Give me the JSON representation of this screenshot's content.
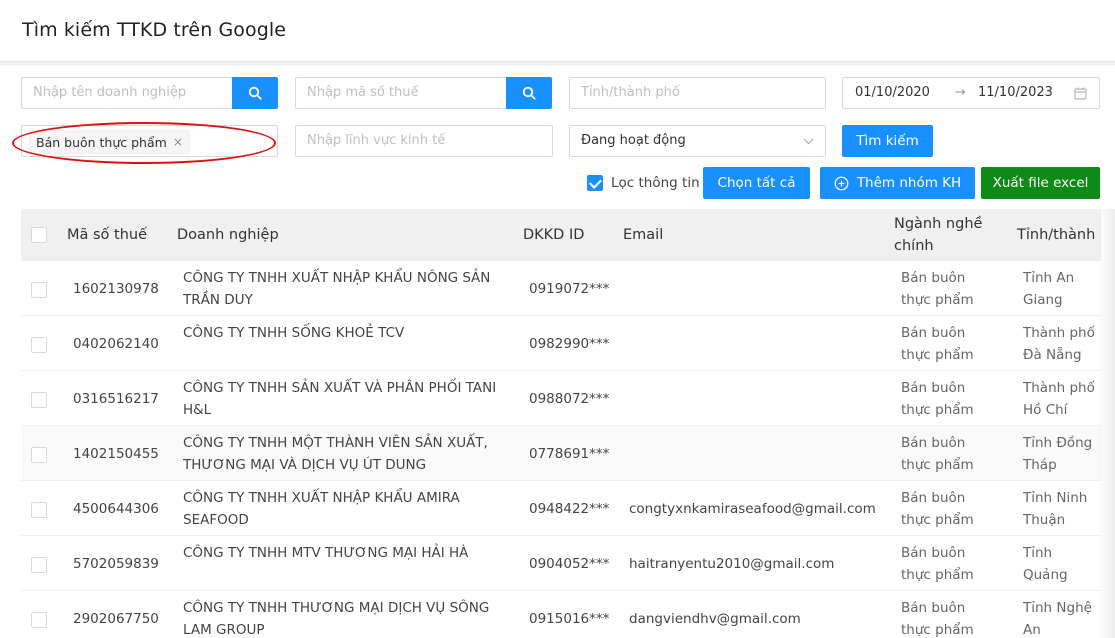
{
  "page": {
    "title": "Tìm kiếm TTKD trên Google"
  },
  "filters": {
    "company_name_placeholder": "Nhập tên doanh nghiệp",
    "tax_code_placeholder": "Nhập mã số thuế",
    "province_placeholder": "Tỉnh/thành phố",
    "date_from": "01/10/2020",
    "date_arrow": "→",
    "date_to": "11/10/2023",
    "industry_tag": "Bán buôn thực phẩm",
    "tag_close": "×",
    "economic_sector_placeholder": "Nhập lĩnh vực kinh tế",
    "status_value": "Đang hoạt động",
    "search_button": "Tìm kiếm"
  },
  "actions": {
    "filter_info_label": "Lọc thông tin",
    "filter_info_checked": true,
    "select_all": "Chọn tất cả",
    "add_group": "Thêm nhóm KH",
    "export_excel": "Xuất file excel"
  },
  "colors": {
    "primary": "#1890ff",
    "export": "#0e8a16",
    "highlight_ellipse": "#e01010"
  },
  "table": {
    "columns": [
      "Mã số thuế",
      "Doanh nghiệp",
      "DKKD ID",
      "Email",
      "Ngành nghề chính",
      "Tỉnh/thành"
    ],
    "rows": [
      {
        "tax": "1602130978",
        "company": "CÔNG TY TNHH XUẤT NHẬP KHẨU NÔNG SẢN TRẦN DUY",
        "dkkd": "0919072***",
        "email": "",
        "industry": "Bán buôn thực phẩm",
        "province": "Tỉnh An Giang"
      },
      {
        "tax": "0402062140",
        "company": "CÔNG TY TNHH SỐNG KHOẺ TCV",
        "dkkd": "0982990***",
        "email": "",
        "industry": "Bán buôn thực phẩm",
        "province": "Thành phố Đà Nẵng"
      },
      {
        "tax": "0316516217",
        "company": "CÔNG TY TNHH SẢN XUẤT VÀ PHÂN PHỐI TANI H&L",
        "dkkd": "0988072***",
        "email": "",
        "industry": "Bán buôn thực phẩm",
        "province": "Thành phố Hồ Chí Minh"
      },
      {
        "tax": "1402150455",
        "company": "CÔNG TY TNHH MỘT THÀNH VIÊN SẢN XUẤT, THƯƠNG MẠI VÀ DỊCH VỤ ÚT DUNG",
        "dkkd": "0778691***",
        "email": "",
        "industry": "Bán buôn thực phẩm",
        "province": "Tỉnh Đồng Tháp"
      },
      {
        "tax": "4500644306",
        "company": "CÔNG TY TNHH XUẤT NHẬP KHẨU AMIRA SEAFOOD",
        "dkkd": "0948422***",
        "email": "congtyxnkamiraseafood@gmail.com",
        "industry": "Bán buôn thực phẩm",
        "province": "Tỉnh Ninh Thuận"
      },
      {
        "tax": "5702059839",
        "company": "CÔNG TY TNHH MTV THƯƠNG MẠI HẢI HÀ",
        "dkkd": "0904052***",
        "email": "haitranyentu2010@gmail.com",
        "industry": "Bán buôn thực phẩm",
        "province": "Tỉnh Quảng Ninh"
      },
      {
        "tax": "2902067750",
        "company": "CÔNG TY TNHH THƯƠNG MẠI DỊCH VỤ SÔNG LAM GROUP",
        "dkkd": "0915016***",
        "email": "dangviendhv@gmail.com",
        "industry": "Bán buôn thực phẩm",
        "province": "Tỉnh Nghệ An"
      }
    ]
  }
}
